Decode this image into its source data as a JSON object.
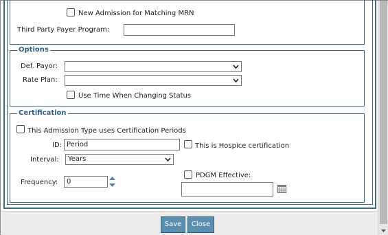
{
  "admission": {
    "new_admission_label": "New Admission for Matching MRN",
    "third_party_label": "Third Party Payer Program:",
    "third_party_value": ""
  },
  "options": {
    "legend": "Options",
    "def_payor_label": "Def. Payor:",
    "def_payor_value": "",
    "rate_plan_label": "Rate Plan:",
    "rate_plan_value": "",
    "use_time_label": "Use Time When Changing Status"
  },
  "certification": {
    "legend": "Certification",
    "uses_periods_label": "This Admission Type uses Certification Periods",
    "id_label": "ID:",
    "id_value": "Period",
    "hospice_label": "This is Hospice certification",
    "interval_label": "Interval:",
    "interval_value": "Years",
    "frequency_label": "Frequency:",
    "frequency_value": "0",
    "pdgm_label": "PDGM Effective:",
    "pdgm_value": ""
  },
  "buttons": {
    "save": "Save",
    "close": "Close"
  },
  "colors": {
    "frame": "#3e6a82",
    "legend": "#2b6187",
    "button": "#5b8fb0"
  },
  "icons": [
    "chevron-down-icon",
    "stepper-icon",
    "calendar-icon",
    "scroll-down-icon"
  ]
}
